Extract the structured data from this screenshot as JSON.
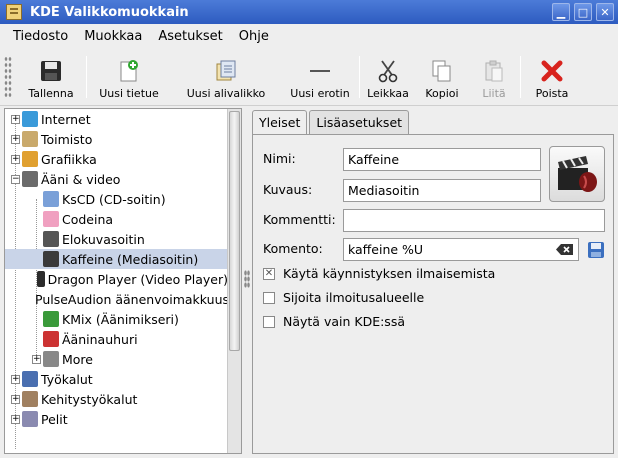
{
  "window": {
    "title": "KDE Valikkomuokkain"
  },
  "menubar": [
    "Tiedosto",
    "Muokkaa",
    "Asetukset",
    "Ohje"
  ],
  "toolbar": {
    "save": "Tallenna",
    "new_item": "Uusi tietue",
    "new_submenu": "Uusi alivalikko",
    "new_separator": "Uusi erotin",
    "cut": "Leikkaa",
    "copy": "Kopioi",
    "paste": "Liitä",
    "delete": "Poista"
  },
  "tree": [
    {
      "label": "Internet",
      "icon": "globe-icon",
      "level": 0,
      "expander": "+"
    },
    {
      "label": "Toimisto",
      "icon": "office-icon",
      "level": 0,
      "expander": "+"
    },
    {
      "label": "Grafiikka",
      "icon": "palette-icon",
      "level": 0,
      "expander": "+"
    },
    {
      "label": "Ääni & video",
      "icon": "multimedia-icon",
      "level": 0,
      "expander": "−"
    },
    {
      "label": "KsCD (CD-soitin)",
      "icon": "cd-icon",
      "level": 1
    },
    {
      "label": "Codeina",
      "icon": "pig-icon",
      "level": 1
    },
    {
      "label": "Elokuvasoitin",
      "icon": "film-icon",
      "level": 1
    },
    {
      "label": "Kaffeine (Mediasoitin)",
      "icon": "clapper-icon",
      "level": 1,
      "selected": true
    },
    {
      "label": "Dragon Player (Video Player)",
      "icon": "dragon-icon",
      "level": 1
    },
    {
      "label": "PulseAudion äänenvoimakkuus",
      "icon": "magnifier-icon",
      "level": 1
    },
    {
      "label": "KMix (Äänimikseri)",
      "icon": "mixer-icon",
      "level": 1
    },
    {
      "label": "Ääninauhuri",
      "icon": "recorder-icon",
      "level": 1
    },
    {
      "label": "More",
      "icon": "more-icon",
      "level": 1,
      "expander": "+"
    },
    {
      "label": "Työkalut",
      "icon": "tools-icon",
      "level": 0,
      "expander": "+"
    },
    {
      "label": "Kehitystyökalut",
      "icon": "devtools-icon",
      "level": 0,
      "expander": "+"
    },
    {
      "label": "Pelit",
      "icon": "gamepad-icon",
      "level": 0,
      "expander": "+"
    }
  ],
  "tabs": {
    "general": "Yleiset",
    "advanced": "Lisäasetukset"
  },
  "form": {
    "name_label": "Nimi:",
    "name_value": "Kaffeine",
    "desc_label": "Kuvaus:",
    "desc_value": "Mediasoitin",
    "comment_label": "Kommentti:",
    "comment_value": "",
    "command_label": "Komento:",
    "command_value": "kaffeine %U",
    "startup_feedback": "Käytä käynnistyksen ilmaisemista",
    "startup_checked": true,
    "systray": "Sijoita ilmoitusalueelle",
    "systray_checked": false,
    "only_kde": "Näytä vain KDE:ssä",
    "only_kde_checked": false
  }
}
